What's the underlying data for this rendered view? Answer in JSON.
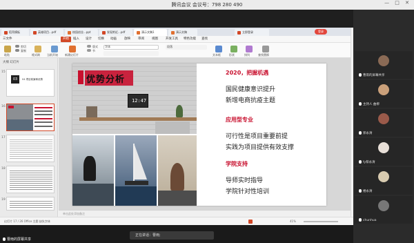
{
  "meeting": {
    "title": "腾讯会议 会议号：798 280 490",
    "controls": "— □ ✕"
  },
  "tabs": [
    {
      "label": "稻壳模板",
      "color": "#d24726",
      "active": false
    },
    {
      "label": "英雄项目...pdf",
      "color": "#d24726",
      "active": false
    },
    {
      "label": "校园创业...ppt",
      "color": "#d24726",
      "active": false
    },
    {
      "label": "发现附近...pdf",
      "color": "#d24726",
      "active": false
    },
    {
      "label": "演示文稿1",
      "color": "#d24726",
      "active": true
    },
    {
      "label": "演示文稿",
      "color": "#d24726",
      "active": false
    },
    {
      "label": "立即登录",
      "color": "#d24726",
      "active": false
    }
  ],
  "tab_login": "登录",
  "ribbon": {
    "menus": [
      "三文件",
      "开始",
      "插入",
      "设计",
      "切换",
      "动画",
      "放映",
      "审阅",
      "视图",
      "开发工具",
      "特色功能",
      "查找"
    ],
    "active_menu": "开始",
    "tools": [
      "粘贴",
      "剪切",
      "复制",
      "格式刷",
      "当前开始",
      "新建幻灯片",
      "版式",
      "节",
      "重置",
      "字体",
      "段落",
      "文本框",
      "形状",
      "排列",
      "查找替换"
    ]
  },
  "outline_tabs": "大纲  幻灯片",
  "thumbs": [
    {
      "num": "15",
      "title": "04 项目前景和优势"
    },
    {
      "num": "16",
      "title": "优势分析"
    },
    {
      "num": "17",
      "title": "财务分析"
    },
    {
      "num": "18",
      "title": "市场预测"
    },
    {
      "num": "19",
      "title": "资金需求"
    }
  ],
  "slide": {
    "heading": "优势分析",
    "clock": "12:47",
    "section1_title": "2020，把握机遇",
    "section1_lines": [
      "国民健康意识提升",
      "新增电商抗疫主题"
    ],
    "section2_title": "应用型专业",
    "section2_lines": [
      "可行性是项目重要前提",
      "实践为项目提供有效支撑"
    ],
    "section3_title": "学院支持",
    "section3_lines": [
      "导师实时指导",
      "学院针对性培训"
    ]
  },
  "notes_placeholder": "单击此处添加备注",
  "status": {
    "left": "幻灯片 17 / 26   Office 主题   缺失字体",
    "zoom": "41%"
  },
  "participants": [
    {
      "name": "曹雨的屏幕共享",
      "color": "#8a6a55"
    },
    {
      "name": "主持人 曲柳",
      "color": "#caa07a"
    },
    {
      "name": "郭永清",
      "color": "#9a5a4a"
    },
    {
      "name": "fy蔡永清",
      "color": "#e8e0d8"
    },
    {
      "name": "楼永清",
      "color": "#d8cbb0"
    },
    {
      "name": "杨",
      "color": "#777"
    },
    {
      "name": "chunhua",
      "color": "#6a8a9a"
    }
  ],
  "sharer": "曹雨的屏幕共享",
  "speaking": "正在讲话：曹雨;",
  "colors": {
    "accent": "#c8102e",
    "wps_orange": "#d24726",
    "meeting_bg": "#1f1f1f"
  }
}
